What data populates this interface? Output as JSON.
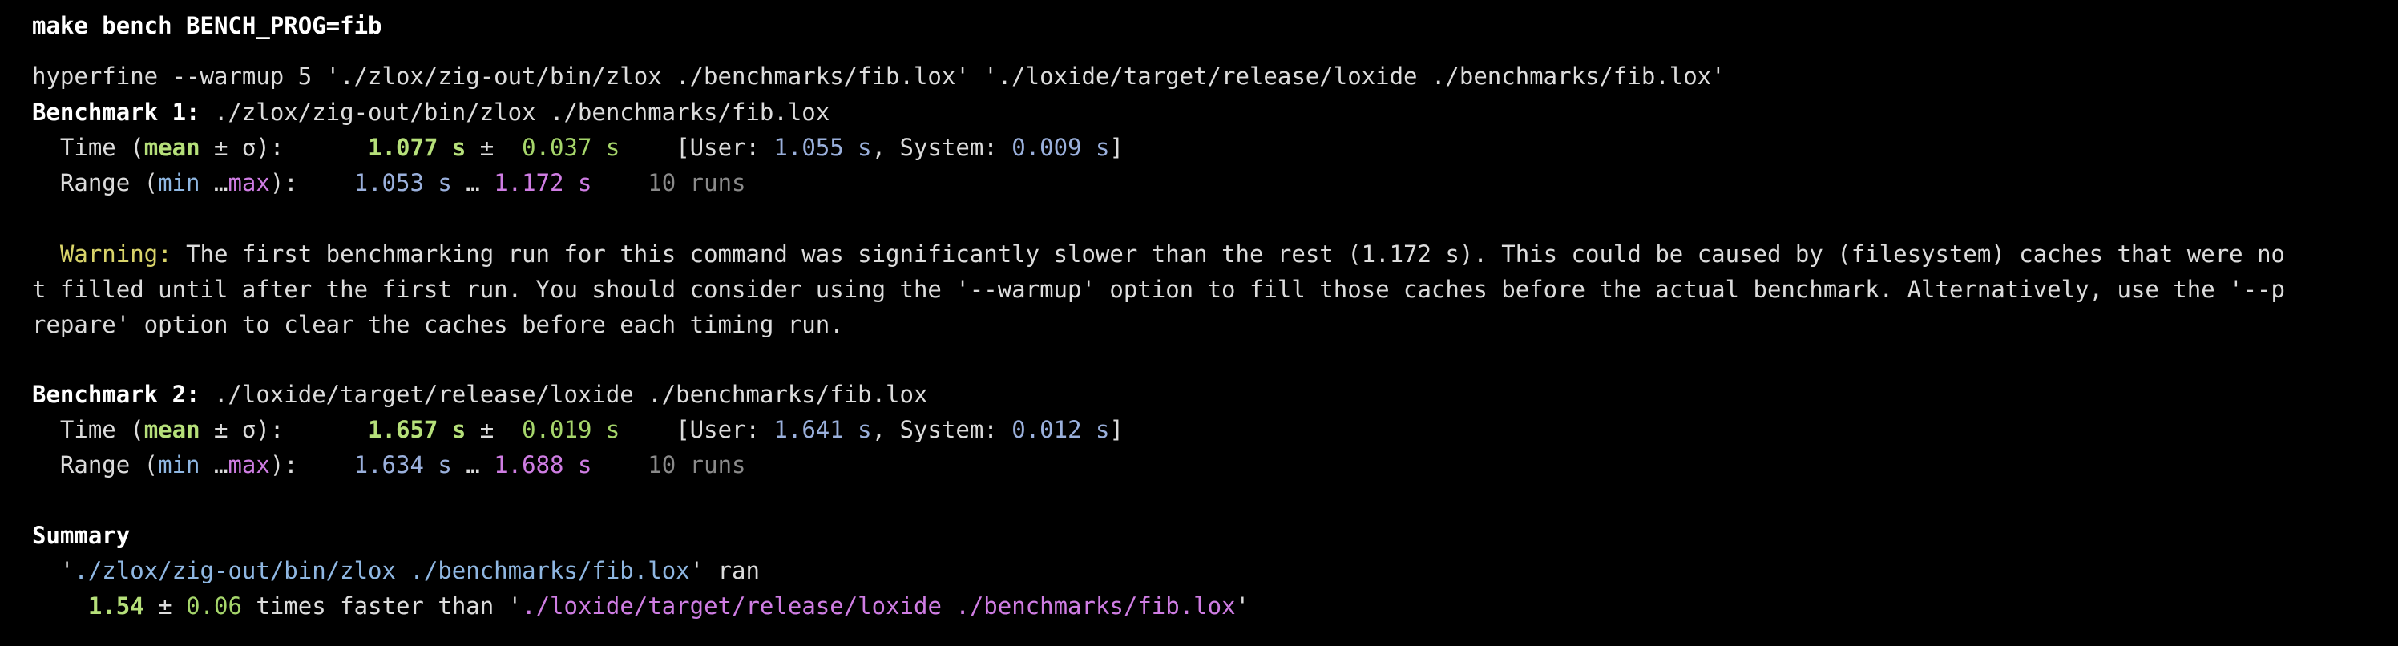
{
  "window": {
    "title": "make bench BENCH_PROG=fib"
  },
  "command": "hyperfine --warmup 5 './zlox/zig-out/bin/zlox ./benchmarks/fib.lox' './loxide/target/release/loxide ./benchmarks/fib.lox'",
  "benchmarks": [
    {
      "label": "Benchmark 1:",
      "command": " ./zlox/zig-out/bin/zlox ./benchmarks/fib.lox",
      "time": {
        "prefix": "  Time (",
        "mean_word": "mean",
        "sigma": " ± σ):",
        "gap": "      ",
        "mean": "1.077 s",
        "pm": " ± ",
        "sd": " 0.037 s",
        "user_prefix": "    [User: ",
        "user": "1.055 s",
        "system_prefix": ", System: ",
        "system": "0.009 s",
        "close": "]"
      },
      "range": {
        "prefix": "  Range (",
        "min_word": "min",
        "ellipsis": " …",
        "max_word": "max",
        "suffix": "):",
        "gap": "    ",
        "min": "1.053 s",
        "sep": " … ",
        "max": "1.172 s",
        "runs": "    10 runs"
      }
    },
    {
      "label": "Benchmark 2:",
      "command": " ./loxide/target/release/loxide ./benchmarks/fib.lox",
      "time": {
        "prefix": "  Time (",
        "mean_word": "mean",
        "sigma": " ± σ):",
        "gap": "      ",
        "mean": "1.657 s",
        "pm": " ± ",
        "sd": " 0.019 s",
        "user_prefix": "    [User: ",
        "user": "1.641 s",
        "system_prefix": ", System: ",
        "system": "0.012 s",
        "close": "]"
      },
      "range": {
        "prefix": "  Range (",
        "min_word": "min",
        "ellipsis": " …",
        "max_word": "max",
        "suffix": "):",
        "gap": "    ",
        "min": "1.634 s",
        "sep": " … ",
        "max": "1.688 s",
        "runs": "    10 runs"
      }
    }
  ],
  "warning": {
    "label": "  Warning:",
    "line1": " The first benchmarking run for this command was significantly slower than the rest (1.172 s). This could be caused by (filesystem) caches that were no",
    "line2": "t filled until after the first run. You should consider using the '--warmup' option to fill those caches before the actual benchmark. Alternatively, use the '--p",
    "line3": "repare' option to clear the caches before each timing run."
  },
  "summary": {
    "heading": "Summary",
    "line1_prefix": "  '",
    "line1_cmd": "./zlox/zig-out/bin/zlox ./benchmarks/fib.lox",
    "line1_suffix": "' ran",
    "ratio_indent": "    ",
    "ratio": "1.54",
    "pm": " ± ",
    "ratio_sd": "0.06",
    "faster_text": " times faster than '",
    "faster_cmd": "./loxide/target/release/loxide ./benchmarks/fib.lox",
    "faster_close": "'"
  },
  "colors": {
    "background": "#000000",
    "text": "#dcdcdc",
    "mean_value": "#b6e07a",
    "user_system": "#9ab0dc",
    "max": "#cf7de3",
    "warning": "#d9d46a",
    "dim": "#8a8a8a"
  }
}
